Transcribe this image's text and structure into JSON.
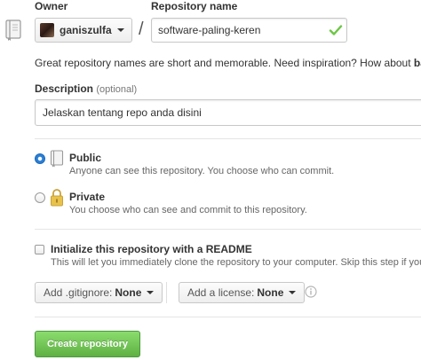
{
  "form": {
    "owner_label": "Owner",
    "repo_name_label": "Repository name",
    "owner_value": "ganiszulfa",
    "slash": "/",
    "repo_name_value": "software-paling-keren",
    "hint_text": "Great repository names are short and memorable. Need inspiration? How about ",
    "hint_suggestion": "balli",
    "description_label": "Description",
    "description_optional": "(optional)",
    "description_placeholder": "Jelaskan tentang repo anda disini"
  },
  "visibility": {
    "selected": "public",
    "public": {
      "title": "Public",
      "description": "Anyone can see this repository. You choose who can commit."
    },
    "private": {
      "title": "Private",
      "description": "You choose who can see and commit to this repository."
    }
  },
  "readme": {
    "checked": false,
    "title": "Initialize this repository with a README",
    "description": "This will let you immediately clone the repository to your computer. Skip this step if you're"
  },
  "options": {
    "gitignore_label": "Add .gitignore:",
    "gitignore_value": "None",
    "license_label": "Add a license:",
    "license_value": "None"
  },
  "actions": {
    "create_label": "Create repository"
  },
  "colors": {
    "create_button": "#60b044",
    "radio_selected": "#2a7fd4",
    "check_valid": "#6cc644",
    "lock": "#e8c24a"
  },
  "icons": {
    "repo": "repo-book-icon",
    "valid": "check-icon",
    "public": "public-book-icon",
    "private": "lock-icon",
    "info": "info-icon"
  }
}
